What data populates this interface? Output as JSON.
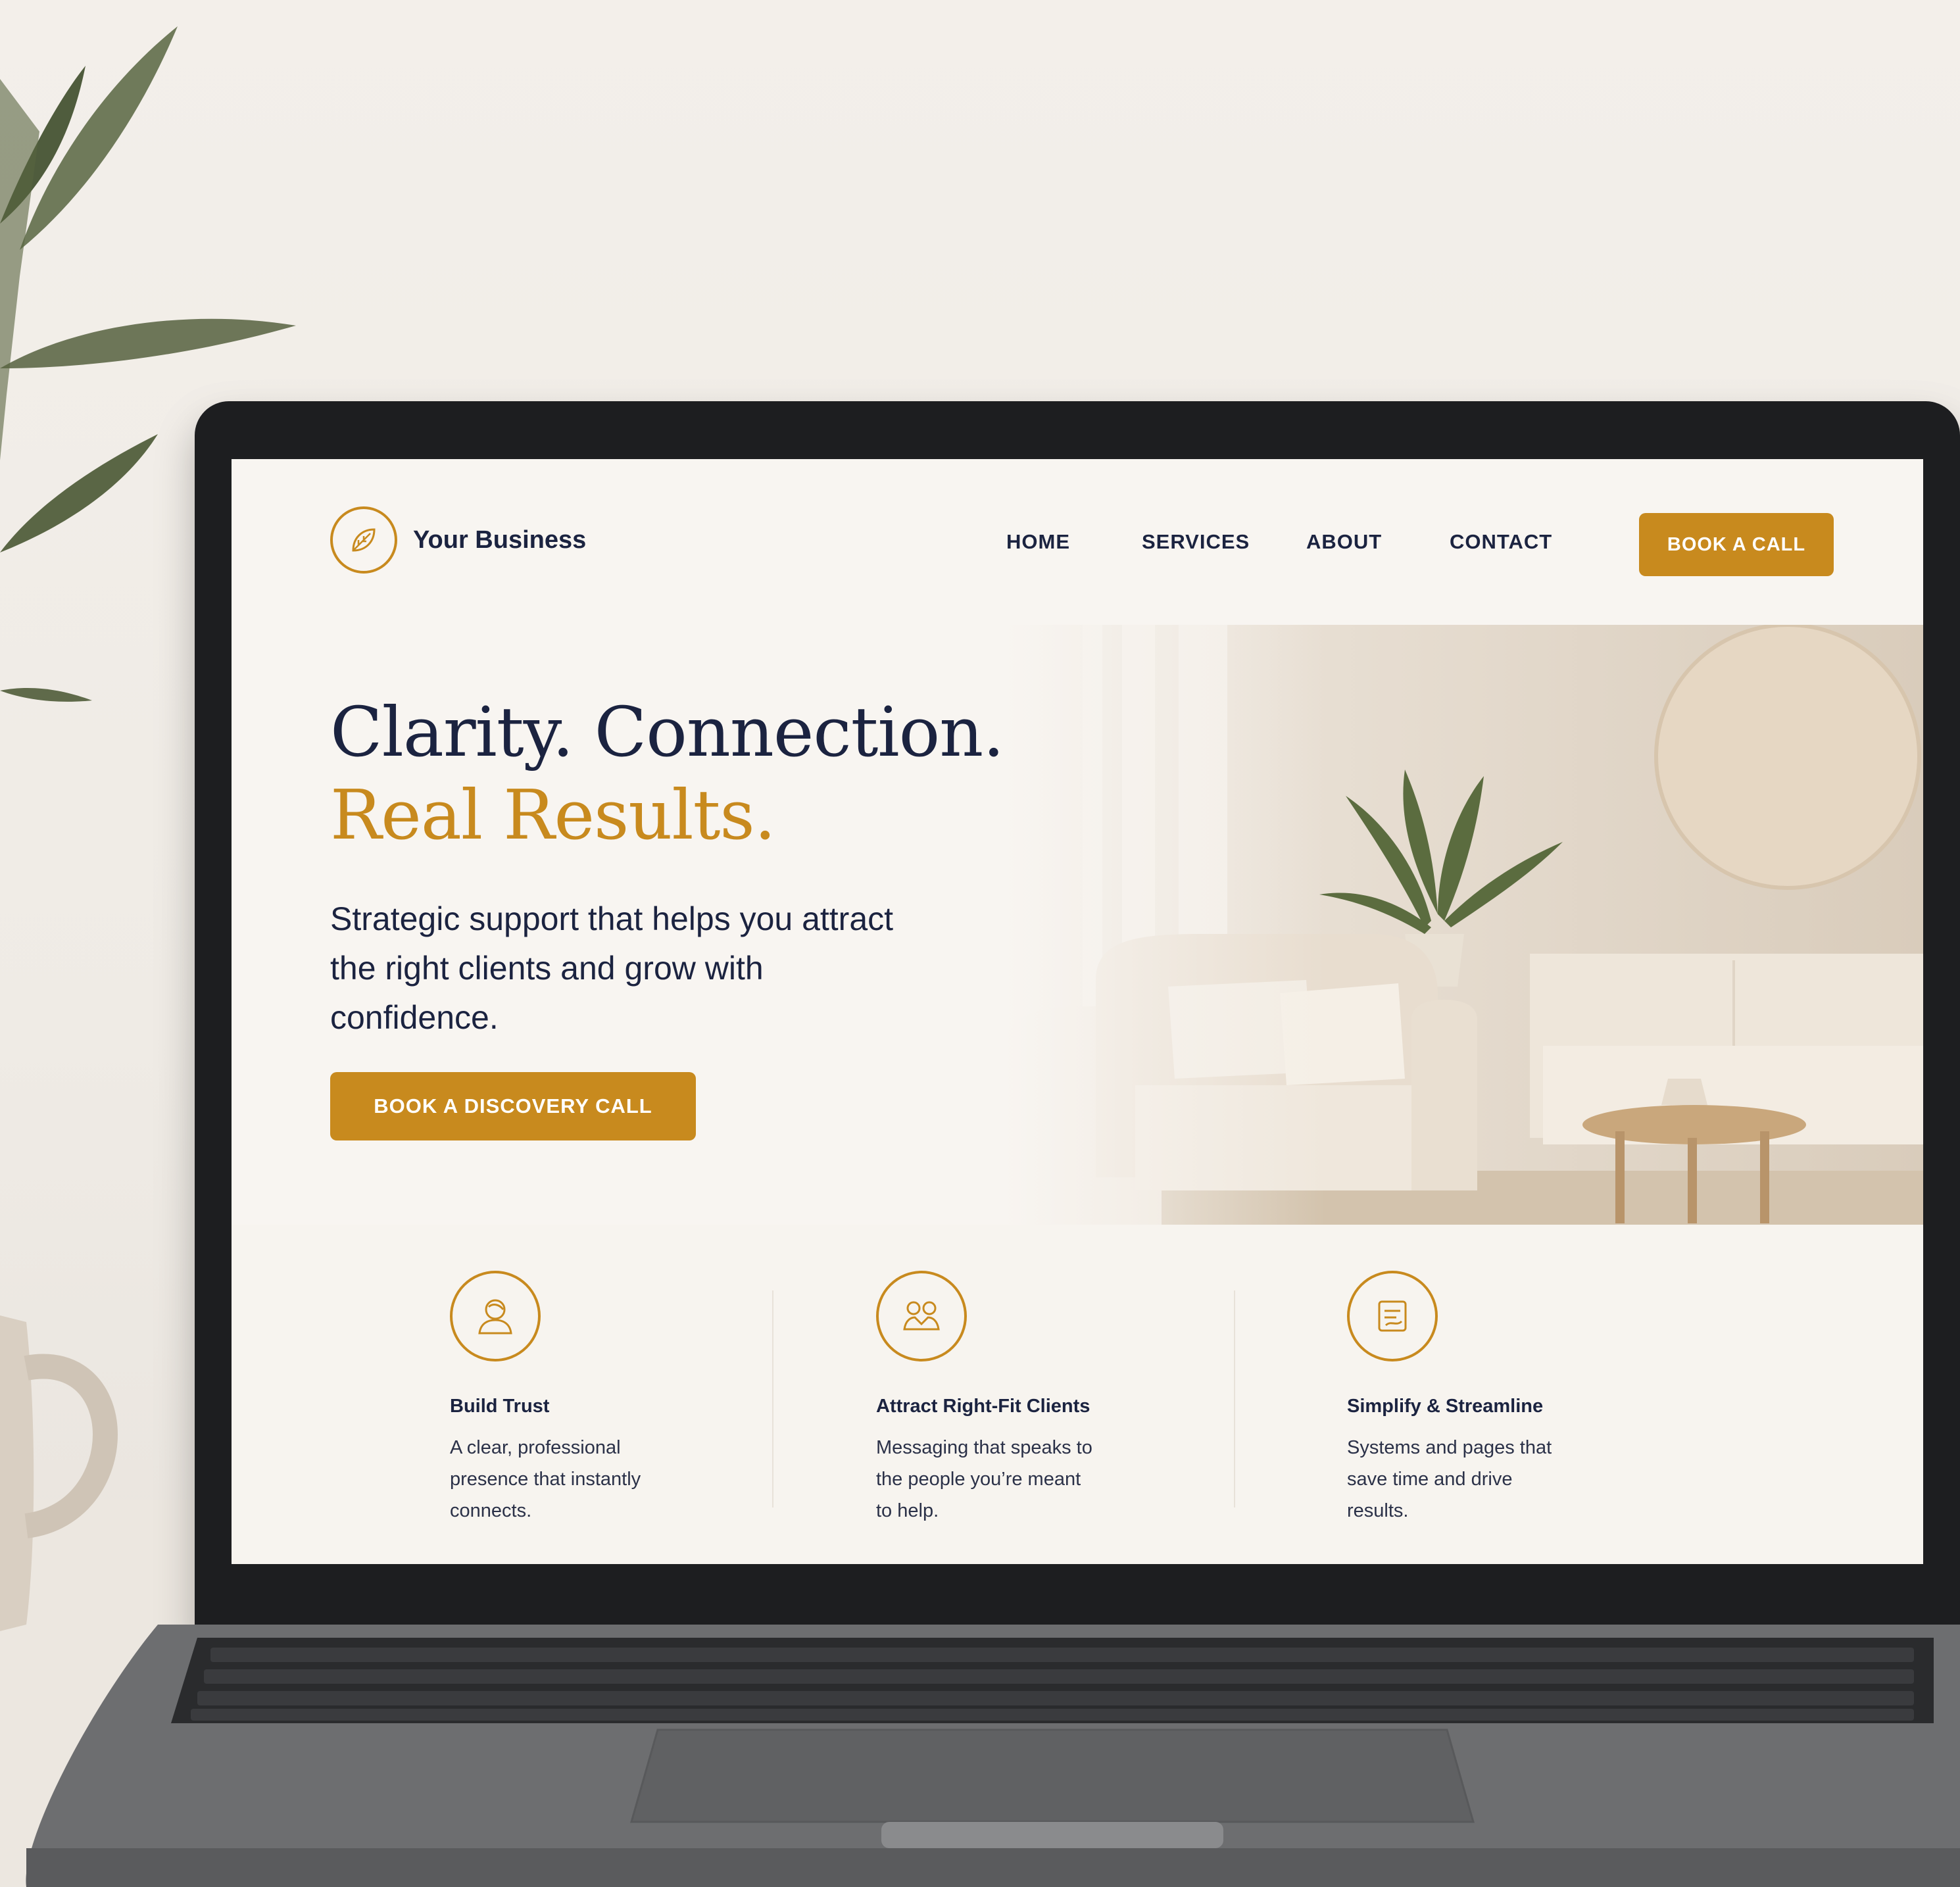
{
  "site": {
    "logo_text": "Your Business",
    "nav": [
      "HOME",
      "SERVICES",
      "ABOUT",
      "CONTACT"
    ],
    "header_cta": "BOOK A CALL"
  },
  "hero": {
    "title_line1": "Clarity. Connection.",
    "title_line2": "Real Results.",
    "subtitle": "Strategic support that helps you attract the right clients and grow with confidence.",
    "cta": "BOOK A DISCOVERY CALL"
  },
  "features": [
    {
      "icon": "person-icon",
      "title": "Build Trust",
      "desc": "A clear, professional presence that instantly connects."
    },
    {
      "icon": "people-connect-icon",
      "title": "Attract Right-Fit Clients",
      "desc": "Messaging that speaks to the people you’re meant to help."
    },
    {
      "icon": "streamline-icon",
      "title": "Simplify & Streamline",
      "desc": "Systems and pages that save time and drive results."
    }
  ],
  "colors": {
    "accent": "#c88a1e",
    "navy": "#1b2340",
    "page_bg": "#f8f5f1"
  }
}
